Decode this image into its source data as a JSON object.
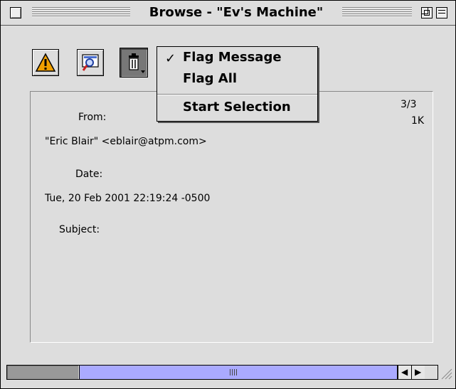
{
  "window": {
    "title": "Browse - \"Ev's Machine\""
  },
  "toolbar": {
    "buttons": [
      {
        "icon": "warning-icon",
        "color": "#f0a000"
      },
      {
        "icon": "search-icon"
      },
      {
        "icon": "trash-icon"
      }
    ]
  },
  "menu": {
    "items": [
      {
        "label": "Flag Message",
        "checked": true
      },
      {
        "label": "Flag All",
        "checked": false
      },
      {
        "label": "Start Selection",
        "checked": false
      }
    ],
    "check_glyph": "✓"
  },
  "message": {
    "counter": "3/3",
    "size": "1K",
    "from_label": "From:",
    "from_value": "\"Eric Blair\" <eblair@atpm.com>",
    "date_label": "Date:",
    "date_value": "Tue, 20 Feb 2001 22:19:24 -0500",
    "subject_label": "Subject:",
    "subject_value": ""
  },
  "scrollbar": {
    "position": 0.4,
    "thumb_color": "#aaaaff"
  }
}
